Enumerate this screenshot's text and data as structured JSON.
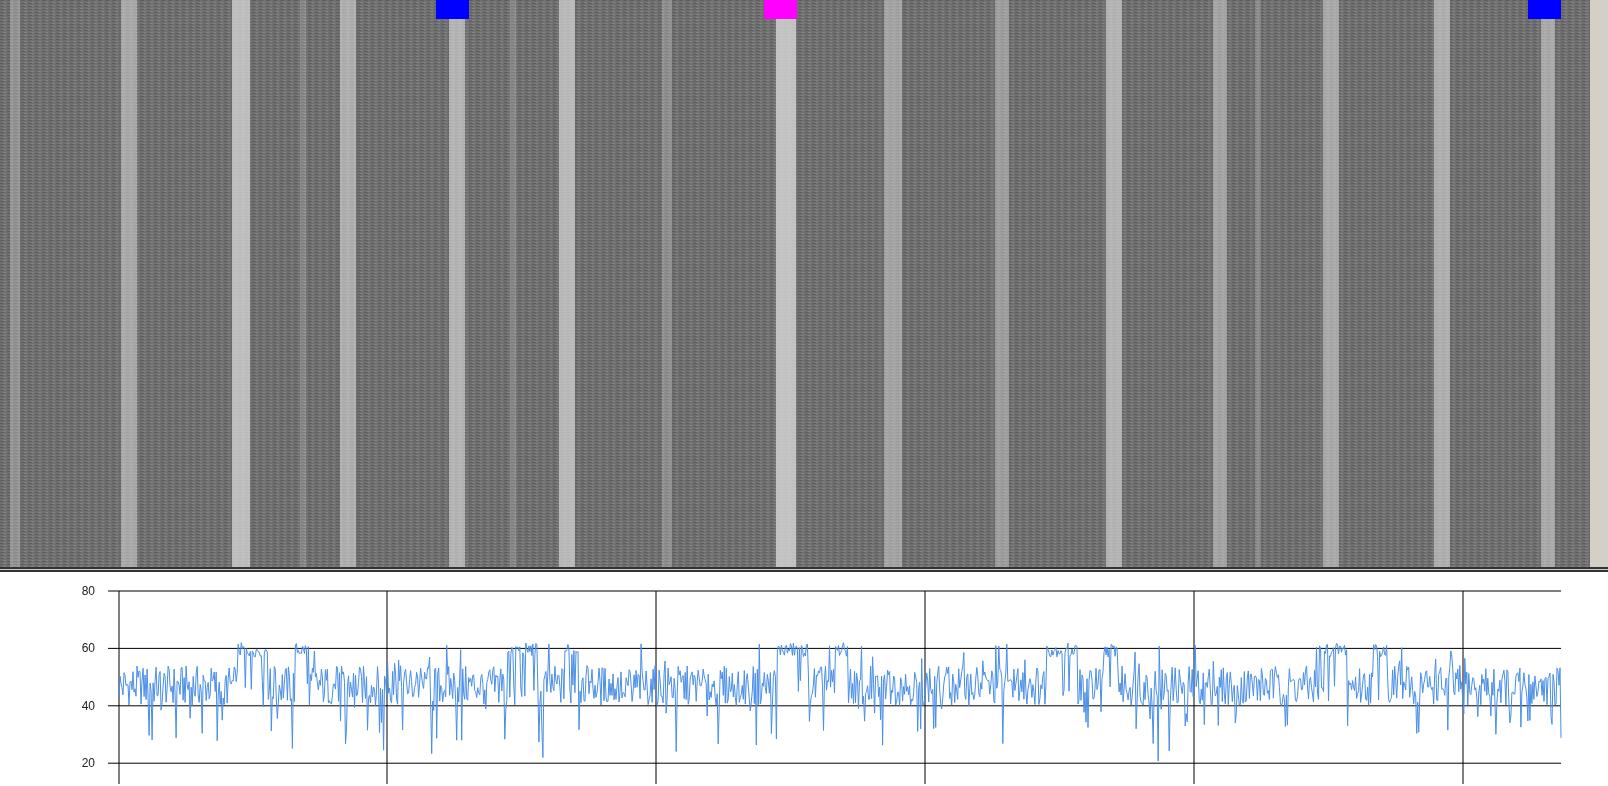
{
  "waterfall": {
    "markers": [
      {
        "color": "#0000ff"
      },
      {
        "color": "#ff00ff"
      },
      {
        "color": "#0000ff"
      }
    ]
  },
  "level_plot": {
    "y_axis_labels": [
      "80",
      "60",
      "40",
      "20"
    ]
  }
}
